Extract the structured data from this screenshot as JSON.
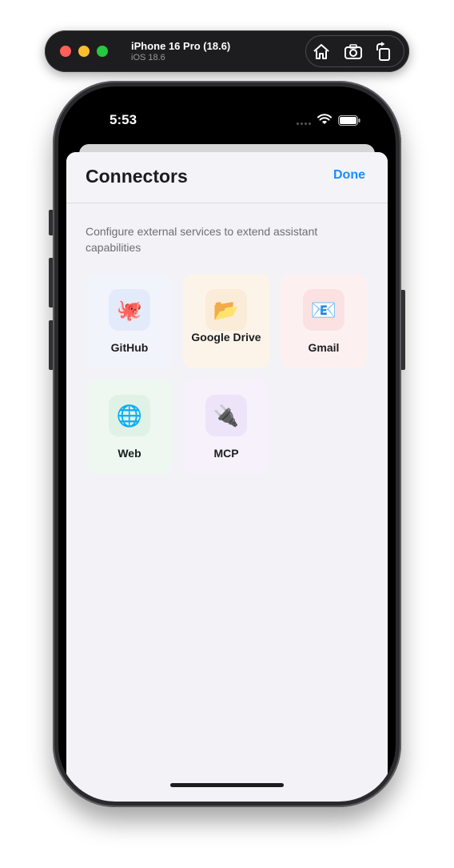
{
  "simulator": {
    "device_name": "iPhone 16 Pro (18.6)",
    "os_version": "iOS 18.6",
    "icons": [
      "home-icon",
      "screenshot-icon",
      "rotate-icon"
    ]
  },
  "status_bar": {
    "time": "5:53",
    "icons": [
      "wifi-icon",
      "battery-icon"
    ]
  },
  "sheet": {
    "title": "Connectors",
    "done_label": "Done",
    "description": "Configure external services to extend assistant capabilities"
  },
  "connectors": [
    {
      "label": "GitHub",
      "icon": "🐙",
      "icon_name": "octopus-icon",
      "accent": "#e3ebfb"
    },
    {
      "label": "Google Drive",
      "icon": "📂",
      "icon_name": "folder-icon",
      "accent": "#fbecd9"
    },
    {
      "label": "Gmail",
      "icon": "📧",
      "icon_name": "email-icon",
      "accent": "#fbe1e2"
    },
    {
      "label": "Web",
      "icon": "🌐",
      "icon_name": "globe-icon",
      "accent": "#e0f2e5"
    },
    {
      "label": "MCP",
      "icon": "🔌",
      "icon_name": "plug-icon",
      "accent": "#eee4fa"
    }
  ],
  "colors": {
    "accent_blue": "#1a8cff",
    "sheet_background": "#f2f2f7",
    "title_text": "#1c1c1e"
  }
}
